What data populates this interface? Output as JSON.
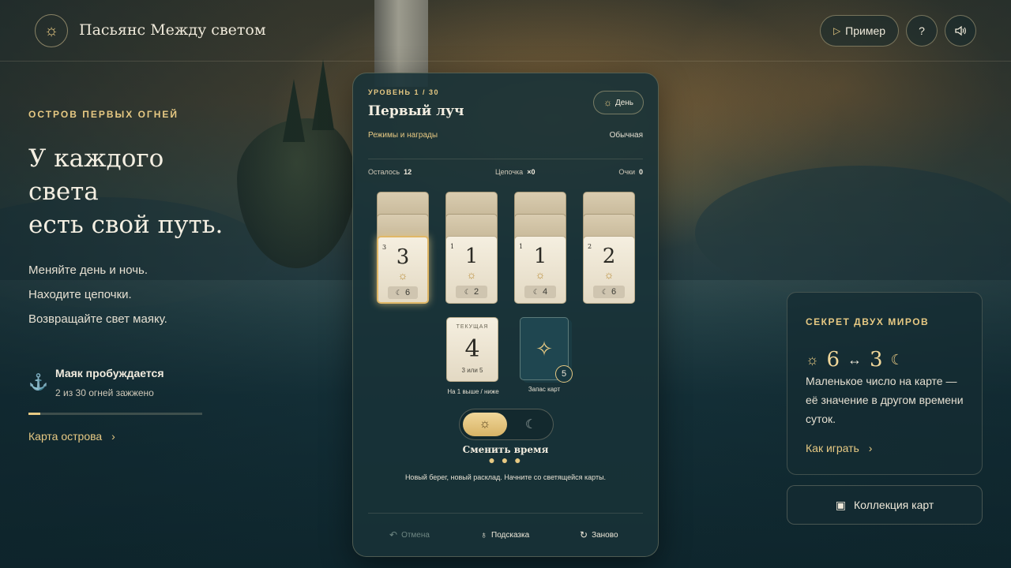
{
  "header": {
    "logo_icon": "sun-icon",
    "title": "Пасьянс Между светом",
    "example_label": "Пример",
    "help_label": "?",
    "sound_icon": "speaker-icon"
  },
  "intro": {
    "kicker": "ОСТРОВ ПЕРВЫХ ОГНЕЙ",
    "headline": [
      "У каждого",
      "света",
      "есть свой путь."
    ],
    "lines": [
      "Меняйте день и ночь.",
      "Находите цепочки.",
      "Возвращайте свет маяку."
    ],
    "progress_title": "Маяк пробуждается",
    "progress_sub": "2 из 30 огней зажжено",
    "progress_fraction": 0.0667,
    "map_link": "Карта острова"
  },
  "game": {
    "level": "УРОВЕНЬ 1 / 30",
    "level_name": "Первый луч",
    "time_label": "День",
    "modes": "Режимы и награды",
    "difficulty": "Обычная",
    "stats": {
      "remaining_label": "Осталось",
      "remaining": "12",
      "chain_label": "Цепочка",
      "chain": "×0",
      "score_label": "Очки",
      "score": "0"
    },
    "columns": [
      {
        "corner": "3",
        "day": "3",
        "night": "6",
        "selected": true
      },
      {
        "corner": "1",
        "day": "1",
        "night": "2",
        "selected": false
      },
      {
        "corner": "1",
        "day": "1",
        "night": "4",
        "selected": false
      },
      {
        "corner": "2",
        "day": "2",
        "night": "6",
        "selected": false
      }
    ],
    "current": {
      "kicker": "ТЕКУЩАЯ",
      "value": "4",
      "options": "3 или 5",
      "caption": "На 1 выше / ниже"
    },
    "deck": {
      "count": "5",
      "caption": "Запас карт"
    },
    "switch_label": "Сменить время",
    "dots": "● ● ●",
    "message": "Новый берег, новый расклад. Начните со светящейся карты.",
    "actions": {
      "undo": "Отмена",
      "hint": "Подсказка",
      "restart": "Заново"
    }
  },
  "secret": {
    "kicker": "СЕКРЕТ ДВУХ МИРОВ",
    "day_value": "6",
    "arrow": "↔",
    "night_value": "3",
    "description": "Маленькое число на карте — её значение в другом времени суток.",
    "how_link": "Как играть"
  },
  "collection_label": "Коллекция карт",
  "colors": {
    "accent": "#e7c983",
    "panel": "#18323a",
    "card": "#f5efe0"
  }
}
